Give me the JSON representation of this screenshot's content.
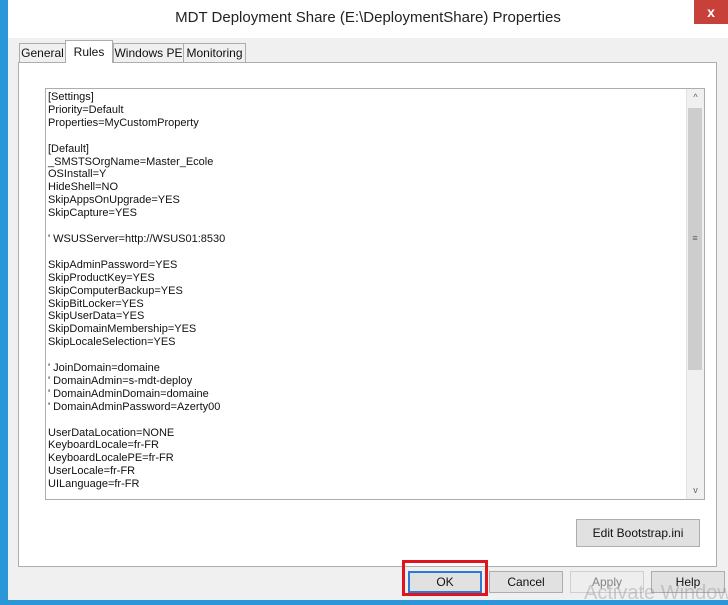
{
  "window": {
    "title": "MDT Deployment Share (E:\\DeploymentShare) Properties",
    "close_label": "x"
  },
  "tabs": [
    {
      "label": "General",
      "active": false
    },
    {
      "label": "Rules",
      "active": true
    },
    {
      "label": "Windows PE",
      "active": false
    },
    {
      "label": "Monitoring",
      "active": false
    }
  ],
  "rules_text": "[Settings]\nPriority=Default\nProperties=MyCustomProperty\n\n[Default]\n_SMSTSOrgName=Master_Ecole\nOSInstall=Y\nHideShell=NO\nSkipAppsOnUpgrade=YES\nSkipCapture=YES\n\n' WSUSServer=http://WSUS01:8530\n\nSkipAdminPassword=YES\nSkipProductKey=YES\nSkipComputerBackup=YES\nSkipBitLocker=YES\nSkipUserData=YES\nSkipDomainMembership=YES\nSkipLocaleSelection=YES\n\n' JoinDomain=domaine\n' DomainAdmin=s-mdt-deploy\n' DomainAdminDomain=domaine\n' DomainAdminPassword=Azerty00\n\nUserDataLocation=NONE\nKeyboardLocale=fr-FR\nKeyboardLocalePE=fr-FR\nUserLocale=fr-FR\nUILanguage=fr-FR",
  "scrollbar": {
    "up_arrow": "^",
    "down_arrow": "v",
    "grip": "≡"
  },
  "edit_bootstrap_label": "Edit Bootstrap.ini",
  "buttons": {
    "ok": "OK",
    "cancel": "Cancel",
    "apply": "Apply",
    "help": "Help"
  },
  "watermark": "Activate Windows"
}
